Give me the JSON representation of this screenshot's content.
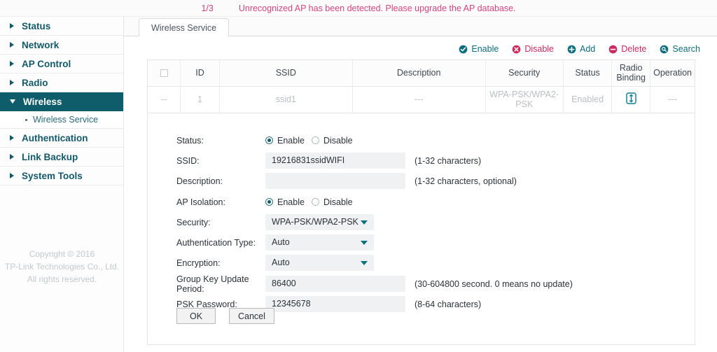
{
  "notice": {
    "index": "1/3",
    "message": "Unrecognized AP has been detected. Please upgrade the AP database.",
    "color": "#d4457e"
  },
  "sidebar": {
    "items": [
      {
        "label": "Status",
        "active": false
      },
      {
        "label": "Network",
        "active": false
      },
      {
        "label": "AP Control",
        "active": false
      },
      {
        "label": "Radio",
        "active": false
      },
      {
        "label": "Wireless",
        "active": true
      },
      {
        "label": "Authentication",
        "active": false
      },
      {
        "label": "Link Backup",
        "active": false
      },
      {
        "label": "System Tools",
        "active": false
      }
    ],
    "submenu": {
      "label": "Wireless Service"
    },
    "copyright": {
      "line1": "Copyright © 2016",
      "line2": "TP-Link Technologies Co., Ltd.",
      "line3": "All rights reserved."
    },
    "active_color": "#0f5c6b",
    "text_color": "#12596b"
  },
  "tab": {
    "label": "Wireless Service"
  },
  "toolbar": {
    "enable_label": "Enable",
    "disable_label": "Disable",
    "add_label": "Add",
    "delete_label": "Delete",
    "search_label": "Search",
    "teal": "#0c6e7e",
    "red": "#cc2b5e"
  },
  "table": {
    "columns": [
      "",
      "ID",
      "SSID",
      "Description",
      "Security",
      "Status",
      "Radio Binding",
      "Operation"
    ],
    "header_checkbox": "checkbox-icon",
    "rows": [
      {
        "select": "--",
        "id": "1",
        "ssid": "ssid1",
        "description": "---",
        "security": "WPA-PSK/WPA2-PSK",
        "status": "Enabled",
        "radio_binding": "radio-binding-icon",
        "operation": "---"
      }
    ]
  },
  "form": {
    "status": {
      "label": "Status:",
      "enable_label": "Enable",
      "disable_label": "Disable",
      "selected": "Enable"
    },
    "ssid": {
      "label": "SSID:",
      "value": "19216831ssidWIFI",
      "hint": "(1-32 characters)"
    },
    "description": {
      "label": "Description:",
      "value": "",
      "placeholder": "",
      "hint": "(1-32 characters, optional)"
    },
    "ap_isolation": {
      "label": "AP Isolation:",
      "enable_label": "Enable",
      "disable_label": "Disable",
      "selected": "Enable"
    },
    "security": {
      "label": "Security:",
      "value": "WPA-PSK/WPA2-PSK"
    },
    "auth_type": {
      "label": "Authentication Type:",
      "value": "Auto"
    },
    "encryption": {
      "label": "Encryption:",
      "value": "Auto"
    },
    "group_key": {
      "label": "Group Key Update Period:",
      "value": "86400",
      "hint": "(30-604800 second. 0 means no update)"
    },
    "psk_password": {
      "label": "PSK Password:",
      "value": "12345678",
      "hint": "(8-64 characters)"
    },
    "ok_label": "OK",
    "cancel_label": "Cancel"
  }
}
